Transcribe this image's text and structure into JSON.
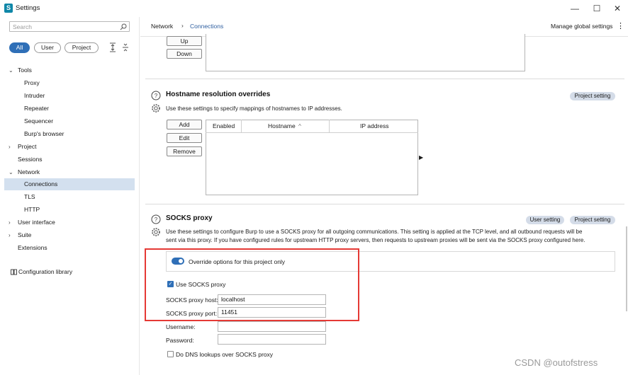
{
  "window": {
    "title": "Settings",
    "controls": {
      "minimize": "—",
      "maximize": "☐",
      "close": "✕"
    }
  },
  "sidebar": {
    "search_placeholder": "Search",
    "filters": [
      "All",
      "User",
      "Project"
    ],
    "items": [
      {
        "label": "Tools",
        "chevron": "⌄",
        "level": 0
      },
      {
        "label": "Proxy",
        "level": 1
      },
      {
        "label": "Intruder",
        "level": 1
      },
      {
        "label": "Repeater",
        "level": 1
      },
      {
        "label": "Sequencer",
        "level": 1
      },
      {
        "label": "Burp's browser",
        "level": 1
      },
      {
        "label": "Project",
        "chevron": "›",
        "level": 0
      },
      {
        "label": "Sessions",
        "level": 0
      },
      {
        "label": "Network",
        "chevron": "⌄",
        "level": 0
      },
      {
        "label": "Connections",
        "level": 1,
        "selected": true
      },
      {
        "label": "TLS",
        "level": 1
      },
      {
        "label": "HTTP",
        "level": 1
      },
      {
        "label": "User interface",
        "chevron": "›",
        "level": 0
      },
      {
        "label": "Suite",
        "chevron": "›",
        "level": 0
      },
      {
        "label": "Extensions",
        "level": 0
      }
    ],
    "configuration_library": "Configuration library"
  },
  "header": {
    "breadcrumb": [
      "Network",
      "Connections"
    ],
    "separator": "›",
    "manage_global": "Manage global settings",
    "kebab": "⋮"
  },
  "upper": {
    "up_button": "Up",
    "down_button": "Down"
  },
  "hostname": {
    "title": "Hostname resolution overrides",
    "tag": "Project setting",
    "description": "Use these settings to specify mappings of hostnames to IP addresses.",
    "buttons": {
      "add": "Add",
      "edit": "Edit",
      "remove": "Remove"
    },
    "columns": [
      "Enabled",
      "Hostname",
      "IP address"
    ],
    "sort_indicator": "^",
    "arrow": "▶"
  },
  "socks": {
    "title": "SOCKS proxy",
    "tags": [
      "User setting",
      "Project setting"
    ],
    "description_1": "Use these settings to configure Burp to use a SOCKS proxy for all outgoing communications. This setting is applied at the TCP level, and all outbound requests will be",
    "description_2": "sent via this proxy. If you have configured rules for upstream HTTP proxy servers, then requests to upstream proxies will be sent via the SOCKS proxy configured here.",
    "override_label": "Override options for this project only",
    "override_on": true,
    "use_socks_label": "Use SOCKS proxy",
    "use_socks_checked": true,
    "checkmark": "✓",
    "host_label": "SOCKS proxy host:",
    "host_value": "localhost",
    "port_label": "SOCKS proxy port:",
    "port_value": "11451",
    "username_label": "Username:",
    "username_value": "",
    "password_label": "Password:",
    "password_value": "",
    "dns_label": "Do DNS lookups over SOCKS proxy",
    "dns_checked": false
  },
  "watermark": "CSDN @outofstress",
  "colors": {
    "accent": "#2f6fb7",
    "selected_bg": "#d3e0ef",
    "tag_bg": "#d4dce8",
    "highlight_box": "#e53935",
    "link": "#2f5fa0"
  }
}
